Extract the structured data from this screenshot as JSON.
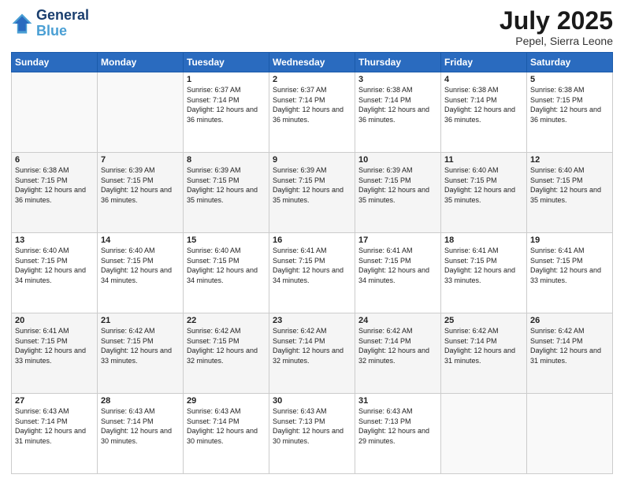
{
  "logo": {
    "line1": "General",
    "line2": "Blue"
  },
  "header": {
    "month": "July 2025",
    "location": "Pepel, Sierra Leone"
  },
  "days_of_week": [
    "Sunday",
    "Monday",
    "Tuesday",
    "Wednesday",
    "Thursday",
    "Friday",
    "Saturday"
  ],
  "weeks": [
    [
      {
        "day": "",
        "info": ""
      },
      {
        "day": "",
        "info": ""
      },
      {
        "day": "1",
        "info": "Sunrise: 6:37 AM\nSunset: 7:14 PM\nDaylight: 12 hours and 36 minutes."
      },
      {
        "day": "2",
        "info": "Sunrise: 6:37 AM\nSunset: 7:14 PM\nDaylight: 12 hours and 36 minutes."
      },
      {
        "day": "3",
        "info": "Sunrise: 6:38 AM\nSunset: 7:14 PM\nDaylight: 12 hours and 36 minutes."
      },
      {
        "day": "4",
        "info": "Sunrise: 6:38 AM\nSunset: 7:14 PM\nDaylight: 12 hours and 36 minutes."
      },
      {
        "day": "5",
        "info": "Sunrise: 6:38 AM\nSunset: 7:15 PM\nDaylight: 12 hours and 36 minutes."
      }
    ],
    [
      {
        "day": "6",
        "info": "Sunrise: 6:38 AM\nSunset: 7:15 PM\nDaylight: 12 hours and 36 minutes."
      },
      {
        "day": "7",
        "info": "Sunrise: 6:39 AM\nSunset: 7:15 PM\nDaylight: 12 hours and 36 minutes."
      },
      {
        "day": "8",
        "info": "Sunrise: 6:39 AM\nSunset: 7:15 PM\nDaylight: 12 hours and 35 minutes."
      },
      {
        "day": "9",
        "info": "Sunrise: 6:39 AM\nSunset: 7:15 PM\nDaylight: 12 hours and 35 minutes."
      },
      {
        "day": "10",
        "info": "Sunrise: 6:39 AM\nSunset: 7:15 PM\nDaylight: 12 hours and 35 minutes."
      },
      {
        "day": "11",
        "info": "Sunrise: 6:40 AM\nSunset: 7:15 PM\nDaylight: 12 hours and 35 minutes."
      },
      {
        "day": "12",
        "info": "Sunrise: 6:40 AM\nSunset: 7:15 PM\nDaylight: 12 hours and 35 minutes."
      }
    ],
    [
      {
        "day": "13",
        "info": "Sunrise: 6:40 AM\nSunset: 7:15 PM\nDaylight: 12 hours and 34 minutes."
      },
      {
        "day": "14",
        "info": "Sunrise: 6:40 AM\nSunset: 7:15 PM\nDaylight: 12 hours and 34 minutes."
      },
      {
        "day": "15",
        "info": "Sunrise: 6:40 AM\nSunset: 7:15 PM\nDaylight: 12 hours and 34 minutes."
      },
      {
        "day": "16",
        "info": "Sunrise: 6:41 AM\nSunset: 7:15 PM\nDaylight: 12 hours and 34 minutes."
      },
      {
        "day": "17",
        "info": "Sunrise: 6:41 AM\nSunset: 7:15 PM\nDaylight: 12 hours and 34 minutes."
      },
      {
        "day": "18",
        "info": "Sunrise: 6:41 AM\nSunset: 7:15 PM\nDaylight: 12 hours and 33 minutes."
      },
      {
        "day": "19",
        "info": "Sunrise: 6:41 AM\nSunset: 7:15 PM\nDaylight: 12 hours and 33 minutes."
      }
    ],
    [
      {
        "day": "20",
        "info": "Sunrise: 6:41 AM\nSunset: 7:15 PM\nDaylight: 12 hours and 33 minutes."
      },
      {
        "day": "21",
        "info": "Sunrise: 6:42 AM\nSunset: 7:15 PM\nDaylight: 12 hours and 33 minutes."
      },
      {
        "day": "22",
        "info": "Sunrise: 6:42 AM\nSunset: 7:15 PM\nDaylight: 12 hours and 32 minutes."
      },
      {
        "day": "23",
        "info": "Sunrise: 6:42 AM\nSunset: 7:14 PM\nDaylight: 12 hours and 32 minutes."
      },
      {
        "day": "24",
        "info": "Sunrise: 6:42 AM\nSunset: 7:14 PM\nDaylight: 12 hours and 32 minutes."
      },
      {
        "day": "25",
        "info": "Sunrise: 6:42 AM\nSunset: 7:14 PM\nDaylight: 12 hours and 31 minutes."
      },
      {
        "day": "26",
        "info": "Sunrise: 6:42 AM\nSunset: 7:14 PM\nDaylight: 12 hours and 31 minutes."
      }
    ],
    [
      {
        "day": "27",
        "info": "Sunrise: 6:43 AM\nSunset: 7:14 PM\nDaylight: 12 hours and 31 minutes."
      },
      {
        "day": "28",
        "info": "Sunrise: 6:43 AM\nSunset: 7:14 PM\nDaylight: 12 hours and 30 minutes."
      },
      {
        "day": "29",
        "info": "Sunrise: 6:43 AM\nSunset: 7:14 PM\nDaylight: 12 hours and 30 minutes."
      },
      {
        "day": "30",
        "info": "Sunrise: 6:43 AM\nSunset: 7:13 PM\nDaylight: 12 hours and 30 minutes."
      },
      {
        "day": "31",
        "info": "Sunrise: 6:43 AM\nSunset: 7:13 PM\nDaylight: 12 hours and 29 minutes."
      },
      {
        "day": "",
        "info": ""
      },
      {
        "day": "",
        "info": ""
      }
    ]
  ]
}
